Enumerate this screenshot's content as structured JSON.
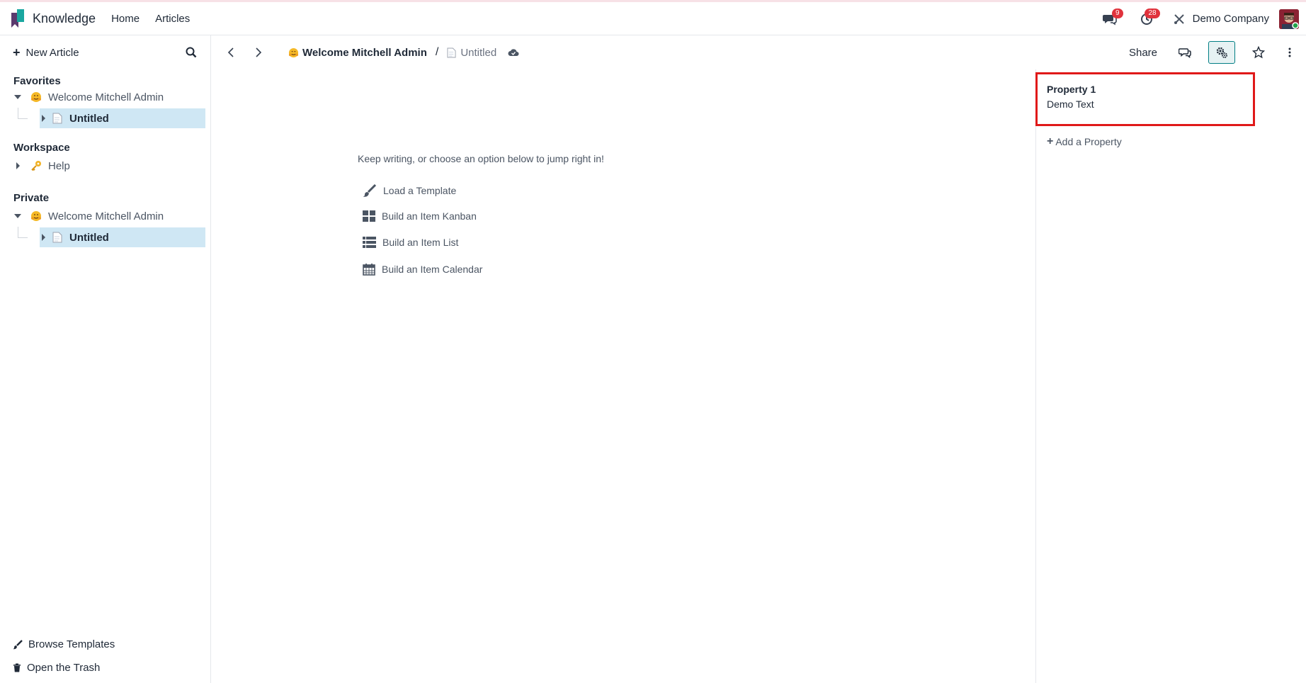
{
  "navbar": {
    "app_name": "Knowledge",
    "links": [
      "Home",
      "Articles"
    ],
    "messages_count": "9",
    "activities_count": "28",
    "company": "Demo Company"
  },
  "sidebar": {
    "new_article": "New Article",
    "sections": {
      "favorites": {
        "title": "Favorites",
        "parent": "Welcome Mitchell Admin",
        "child": "Untitled"
      },
      "workspace": {
        "title": "Workspace",
        "item": "Help"
      },
      "private": {
        "title": "Private",
        "parent": "Welcome Mitchell Admin",
        "child": "Untitled"
      }
    },
    "browse_templates": "Browse Templates",
    "open_trash": "Open the Trash"
  },
  "header": {
    "parent_article": "Welcome Mitchell Admin",
    "separator": "/",
    "current_article": "Untitled",
    "share": "Share"
  },
  "editor": {
    "hint": "Keep writing, or choose an option below to jump right in!",
    "options": [
      {
        "label": "Load a Template",
        "icon": "paintbrush-icon"
      },
      {
        "label": "Build an Item Kanban",
        "icon": "kanban-icon"
      },
      {
        "label": "Build an Item List",
        "icon": "list-icon"
      },
      {
        "label": "Build an Item Calendar",
        "icon": "calendar-icon"
      }
    ]
  },
  "properties": {
    "label": "Property 1",
    "value": "Demo Text",
    "add": "Add a Property"
  },
  "colors": {
    "accent": "#017e84",
    "selected_bg": "#cfe7f4",
    "highlight_border": "#e01919",
    "badge": "#e0323c"
  }
}
